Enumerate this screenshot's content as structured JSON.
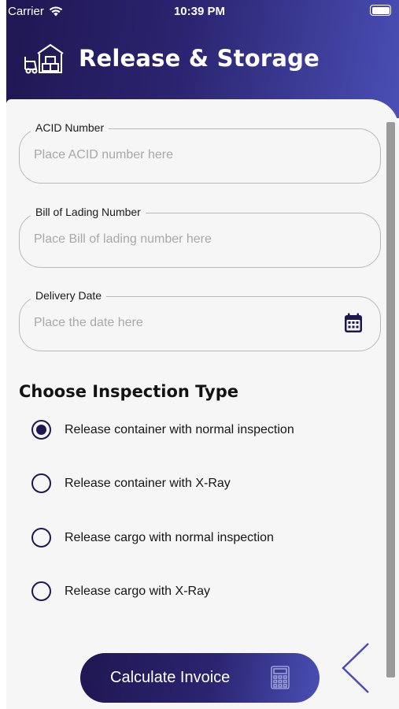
{
  "status_bar": {
    "carrier": "Carrier",
    "time": "10:39 PM"
  },
  "header": {
    "title": "Release & Storage",
    "icon": "warehouse-forklift-icon"
  },
  "form": {
    "acid": {
      "label": "ACID Number",
      "placeholder": "Place ACID number here"
    },
    "bill": {
      "label": "Bill of Lading Number",
      "placeholder": "Place Bill of lading number here"
    },
    "date": {
      "label": "Delivery Date",
      "placeholder": "Place the date here",
      "icon": "calendar-icon"
    }
  },
  "inspection": {
    "title": "Choose Inspection Type",
    "options": [
      {
        "label": "Release container with normal inspection",
        "selected": true
      },
      {
        "label": "Release container with X-Ray",
        "selected": false
      },
      {
        "label": "Release cargo with normal inspection",
        "selected": false
      },
      {
        "label": "Release cargo with X-Ray",
        "selected": false
      }
    ]
  },
  "actions": {
    "calculate_label": "Calculate Invoice",
    "calculate_icon": "calculator-icon",
    "back_icon": "chevron-left-icon"
  },
  "colors": {
    "primary": "#1f1752",
    "accent": "#4a4fb5",
    "sheet": "#f6f6f6",
    "placeholder": "#a8a8a8"
  }
}
